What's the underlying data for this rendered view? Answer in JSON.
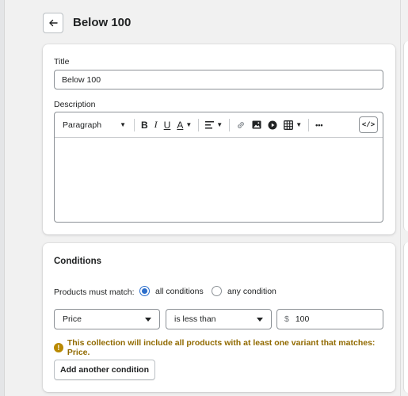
{
  "page": {
    "title": "Below 100"
  },
  "form": {
    "title_label": "Title",
    "title_value": "Below 100",
    "description_label": "Description"
  },
  "editor": {
    "paragraph_label": "Paragraph",
    "bold": "B",
    "italic": "I",
    "underline": "U",
    "text_color": "A",
    "more": "•••",
    "code": "</>"
  },
  "conditions": {
    "heading": "Conditions",
    "match_label": "Products must match:",
    "option_all": "all conditions",
    "option_any": "any condition",
    "selected": "all",
    "field_select": "Price",
    "operator_select": "is less than",
    "currency": "$",
    "value": "100",
    "warning": "This collection will include all products with at least one variant that matches: Price.",
    "add_button": "Add another condition"
  },
  "colors": {
    "accent": "#2c6ecb",
    "warning": "#916a00"
  }
}
